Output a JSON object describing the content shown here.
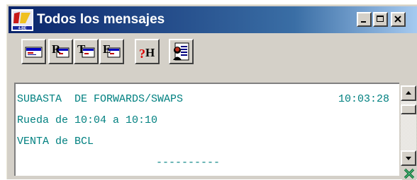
{
  "window": {
    "title": "Todos los mensajes",
    "app_icon": "app-logo-icon",
    "controls": {
      "minimize_icon": "minimize-icon",
      "maximize_icon": "maximize-icon",
      "close_icon": "close-icon"
    }
  },
  "toolbar": {
    "buttons": [
      {
        "name": "all-messages-icon",
        "glyph": ""
      },
      {
        "name": "r-messages-icon",
        "glyph": "R"
      },
      {
        "name": "t-messages-icon",
        "glyph": "T"
      },
      {
        "name": "e-messages-icon",
        "glyph": "E"
      },
      {
        "name": "help-icon",
        "glyph": "?H"
      },
      {
        "name": "user-report-icon",
        "glyph": ""
      }
    ]
  },
  "messages": {
    "line1": "SUBASTA  DE FORWARDS/SWAPS",
    "time": "10:03:28",
    "line2": "Rueda de 10:04 a 10:10",
    "line3": "VENTA de BCL",
    "separator": "----------"
  },
  "scrollbar": {
    "up_icon": "scroll-up-arrow-icon",
    "down_icon": "scroll-down-arrow-icon",
    "export_icon": "excel-export-icon"
  },
  "colors": {
    "title_start": "#0a246a",
    "title_end": "#a6caf0",
    "message_text": "#008080",
    "window_face": "#d4d0c8"
  }
}
